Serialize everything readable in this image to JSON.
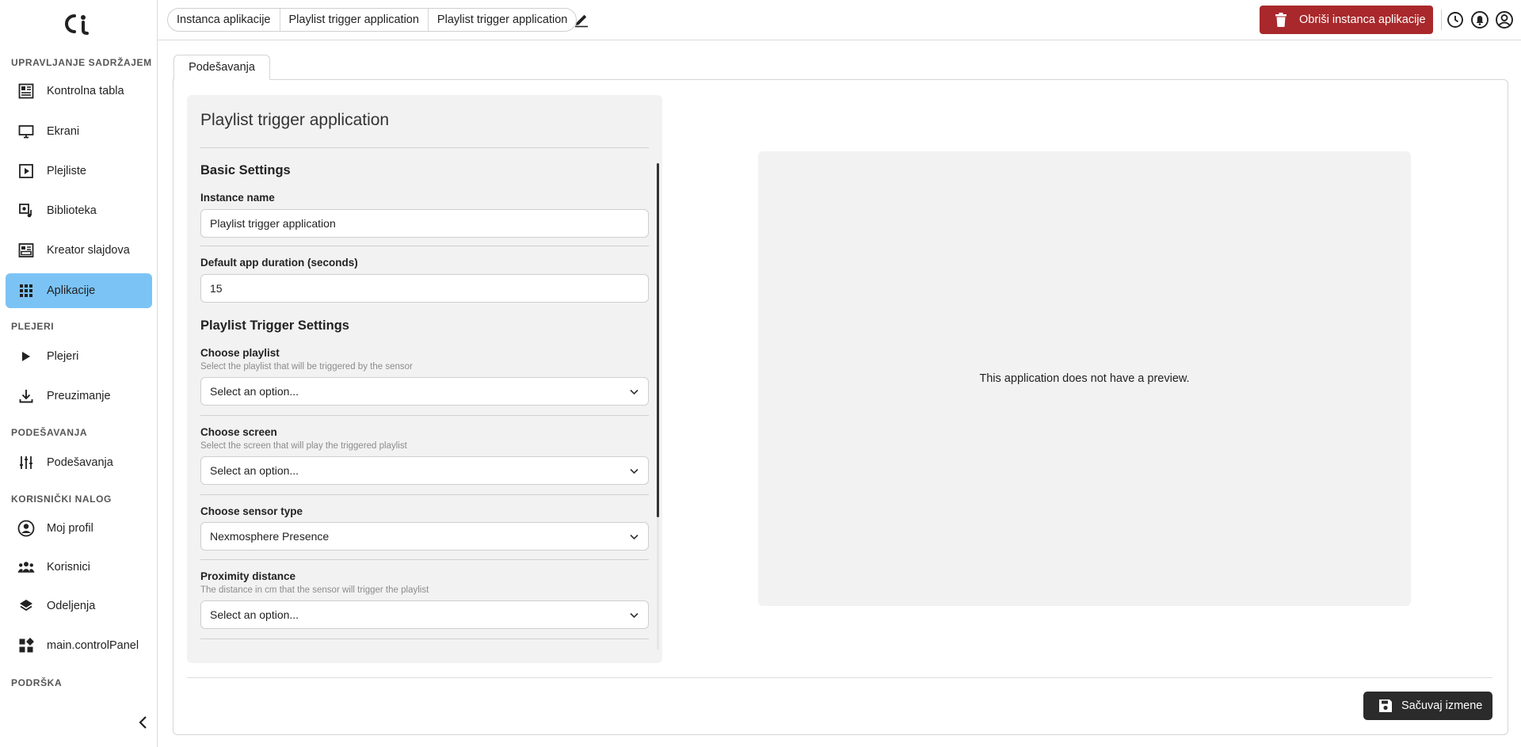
{
  "colors": {
    "accent": "#7cc3f5",
    "danger": "#a8282b",
    "dark_button": "#2b2b2b"
  },
  "sidebar": {
    "logo_icon": "ci-logo-icon",
    "sections": {
      "content": "UPRAVLJANJE SADRŽAJEM",
      "players": "PLEJERI",
      "settings": "PODEŠAVANJA",
      "account": "KORISNIČKI NALOG",
      "support": "PODRŠKA"
    },
    "items": [
      {
        "label": "Kontrolna tabla",
        "icon": "dashboard-icon"
      },
      {
        "label": "Ekrani",
        "icon": "monitor-icon"
      },
      {
        "label": "Plejliste",
        "icon": "playlist-icon"
      },
      {
        "label": "Biblioteka",
        "icon": "media-library-icon"
      },
      {
        "label": "Kreator slajdova",
        "icon": "slide-creator-icon"
      },
      {
        "label": "Aplikacije",
        "icon": "apps-grid-icon",
        "active": true
      },
      {
        "label": "Plejeri",
        "icon": "play-icon"
      },
      {
        "label": "Preuzimanje",
        "icon": "download-icon"
      },
      {
        "label": "Podešavanja",
        "icon": "sliders-icon"
      },
      {
        "label": "Moj profil",
        "icon": "user-circle-icon"
      },
      {
        "label": "Korisnici",
        "icon": "users-icon"
      },
      {
        "label": "Odeljenja",
        "icon": "layers-icon"
      },
      {
        "label": "main.controlPanel",
        "icon": "widgets-icon"
      }
    ],
    "collapse_icon": "chevron-left-icon"
  },
  "topbar": {
    "breadcrumbs": [
      "Instanca aplikacije",
      "Playlist trigger application",
      "Playlist trigger application"
    ],
    "edit_icon": "pencil-icon",
    "delete_label": "Obriši instanca aplikacije",
    "icons": [
      "clock-icon",
      "bell-icon",
      "account-icon"
    ]
  },
  "main": {
    "tab_label": "Podešavanja",
    "form": {
      "title": "Playlist trigger application",
      "basic_settings": "Basic Settings",
      "instance_name_label": "Instance name",
      "instance_name_value": "Playlist trigger application",
      "duration_label": "Default app duration (seconds)",
      "duration_value": "15",
      "trigger_settings": "Playlist Trigger Settings",
      "playlist_label": "Choose playlist",
      "playlist_hint": "Select the playlist that will be triggered by the sensor",
      "playlist_value": "Select an option...",
      "screen_label": "Choose screen",
      "screen_hint": "Select the screen that will play the triggered playlist",
      "screen_value": "Select an option...",
      "sensor_label": "Choose sensor type",
      "sensor_value": "Nexmosphere Presence",
      "proximity_label": "Proximity distance",
      "proximity_hint": "The distance in cm that the sensor will trigger the playlist",
      "proximity_value": "Select an option..."
    },
    "preview_text": "This application does not have a preview.",
    "save_label": "Sačuvaj izmene"
  }
}
